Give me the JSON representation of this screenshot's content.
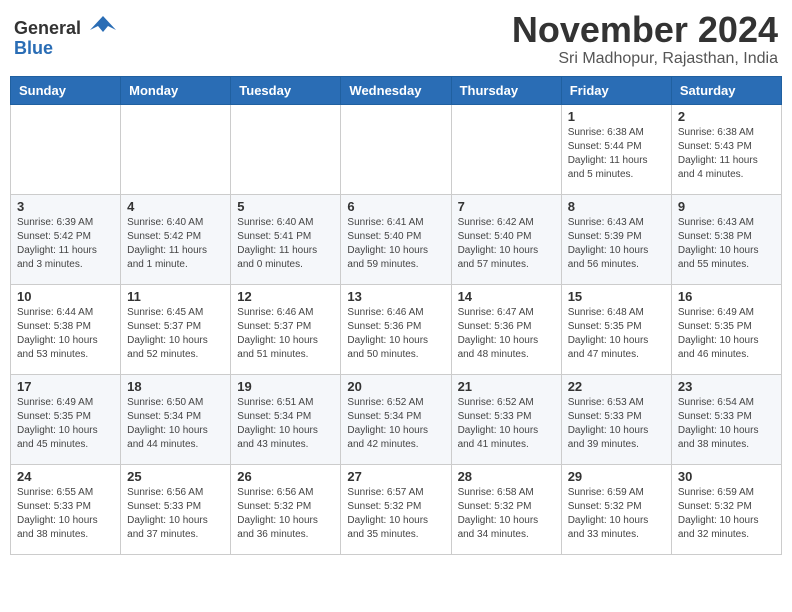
{
  "header": {
    "logo": {
      "general": "General",
      "blue": "Blue"
    },
    "title": "November 2024",
    "subtitle": "Sri Madhopur, Rajasthan, India"
  },
  "weekdays": [
    "Sunday",
    "Monday",
    "Tuesday",
    "Wednesday",
    "Thursday",
    "Friday",
    "Saturday"
  ],
  "weeks": [
    [
      {
        "day": "",
        "info": ""
      },
      {
        "day": "",
        "info": ""
      },
      {
        "day": "",
        "info": ""
      },
      {
        "day": "",
        "info": ""
      },
      {
        "day": "",
        "info": ""
      },
      {
        "day": "1",
        "info": "Sunrise: 6:38 AM\nSunset: 5:44 PM\nDaylight: 11 hours and 5 minutes."
      },
      {
        "day": "2",
        "info": "Sunrise: 6:38 AM\nSunset: 5:43 PM\nDaylight: 11 hours and 4 minutes."
      }
    ],
    [
      {
        "day": "3",
        "info": "Sunrise: 6:39 AM\nSunset: 5:42 PM\nDaylight: 11 hours and 3 minutes."
      },
      {
        "day": "4",
        "info": "Sunrise: 6:40 AM\nSunset: 5:42 PM\nDaylight: 11 hours and 1 minute."
      },
      {
        "day": "5",
        "info": "Sunrise: 6:40 AM\nSunset: 5:41 PM\nDaylight: 11 hours and 0 minutes."
      },
      {
        "day": "6",
        "info": "Sunrise: 6:41 AM\nSunset: 5:40 PM\nDaylight: 10 hours and 59 minutes."
      },
      {
        "day": "7",
        "info": "Sunrise: 6:42 AM\nSunset: 5:40 PM\nDaylight: 10 hours and 57 minutes."
      },
      {
        "day": "8",
        "info": "Sunrise: 6:43 AM\nSunset: 5:39 PM\nDaylight: 10 hours and 56 minutes."
      },
      {
        "day": "9",
        "info": "Sunrise: 6:43 AM\nSunset: 5:38 PM\nDaylight: 10 hours and 55 minutes."
      }
    ],
    [
      {
        "day": "10",
        "info": "Sunrise: 6:44 AM\nSunset: 5:38 PM\nDaylight: 10 hours and 53 minutes."
      },
      {
        "day": "11",
        "info": "Sunrise: 6:45 AM\nSunset: 5:37 PM\nDaylight: 10 hours and 52 minutes."
      },
      {
        "day": "12",
        "info": "Sunrise: 6:46 AM\nSunset: 5:37 PM\nDaylight: 10 hours and 51 minutes."
      },
      {
        "day": "13",
        "info": "Sunrise: 6:46 AM\nSunset: 5:36 PM\nDaylight: 10 hours and 50 minutes."
      },
      {
        "day": "14",
        "info": "Sunrise: 6:47 AM\nSunset: 5:36 PM\nDaylight: 10 hours and 48 minutes."
      },
      {
        "day": "15",
        "info": "Sunrise: 6:48 AM\nSunset: 5:35 PM\nDaylight: 10 hours and 47 minutes."
      },
      {
        "day": "16",
        "info": "Sunrise: 6:49 AM\nSunset: 5:35 PM\nDaylight: 10 hours and 46 minutes."
      }
    ],
    [
      {
        "day": "17",
        "info": "Sunrise: 6:49 AM\nSunset: 5:35 PM\nDaylight: 10 hours and 45 minutes."
      },
      {
        "day": "18",
        "info": "Sunrise: 6:50 AM\nSunset: 5:34 PM\nDaylight: 10 hours and 44 minutes."
      },
      {
        "day": "19",
        "info": "Sunrise: 6:51 AM\nSunset: 5:34 PM\nDaylight: 10 hours and 43 minutes."
      },
      {
        "day": "20",
        "info": "Sunrise: 6:52 AM\nSunset: 5:34 PM\nDaylight: 10 hours and 42 minutes."
      },
      {
        "day": "21",
        "info": "Sunrise: 6:52 AM\nSunset: 5:33 PM\nDaylight: 10 hours and 41 minutes."
      },
      {
        "day": "22",
        "info": "Sunrise: 6:53 AM\nSunset: 5:33 PM\nDaylight: 10 hours and 39 minutes."
      },
      {
        "day": "23",
        "info": "Sunrise: 6:54 AM\nSunset: 5:33 PM\nDaylight: 10 hours and 38 minutes."
      }
    ],
    [
      {
        "day": "24",
        "info": "Sunrise: 6:55 AM\nSunset: 5:33 PM\nDaylight: 10 hours and 38 minutes."
      },
      {
        "day": "25",
        "info": "Sunrise: 6:56 AM\nSunset: 5:33 PM\nDaylight: 10 hours and 37 minutes."
      },
      {
        "day": "26",
        "info": "Sunrise: 6:56 AM\nSunset: 5:32 PM\nDaylight: 10 hours and 36 minutes."
      },
      {
        "day": "27",
        "info": "Sunrise: 6:57 AM\nSunset: 5:32 PM\nDaylight: 10 hours and 35 minutes."
      },
      {
        "day": "28",
        "info": "Sunrise: 6:58 AM\nSunset: 5:32 PM\nDaylight: 10 hours and 34 minutes."
      },
      {
        "day": "29",
        "info": "Sunrise: 6:59 AM\nSunset: 5:32 PM\nDaylight: 10 hours and 33 minutes."
      },
      {
        "day": "30",
        "info": "Sunrise: 6:59 AM\nSunset: 5:32 PM\nDaylight: 10 hours and 32 minutes."
      }
    ]
  ]
}
